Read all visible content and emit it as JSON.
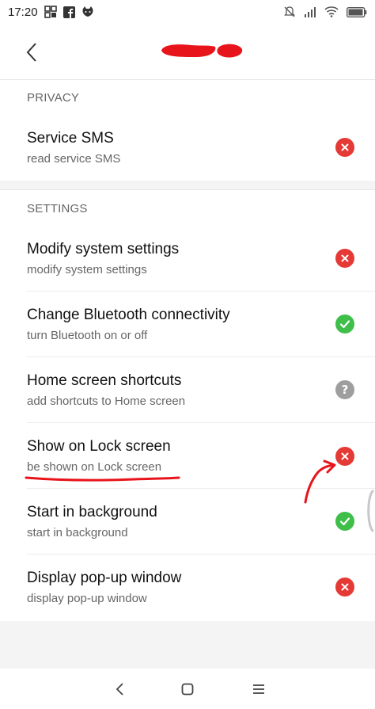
{
  "status_bar": {
    "time": "17:20",
    "left_icons": [
      "gallery-icon",
      "facebook-icon",
      "cat-icon"
    ],
    "right_icons": [
      "mute-bell-icon",
      "signal-icon",
      "wifi-icon",
      "battery-icon"
    ]
  },
  "header": {
    "back_icon": "back-chevron-icon",
    "title_redacted": true,
    "redaction_color": "#e8141b"
  },
  "sections": [
    {
      "header": "PRIVACY",
      "items": [
        {
          "title": "Service SMS",
          "subtitle": "read service SMS",
          "status": "denied"
        }
      ]
    },
    {
      "header": "SETTINGS",
      "items": [
        {
          "title": "Modify system settings",
          "subtitle": "modify system settings",
          "status": "denied"
        },
        {
          "title": "Change Bluetooth connectivity",
          "subtitle": "turn Bluetooth on or off",
          "status": "allowed"
        },
        {
          "title": "Home screen shortcuts",
          "subtitle": "add shortcuts to Home screen",
          "status": "ask"
        },
        {
          "title": "Show on Lock screen",
          "subtitle": "be shown on Lock screen",
          "status": "denied"
        },
        {
          "title": "Start in background",
          "subtitle": "start in background",
          "status": "allowed"
        },
        {
          "title": "Display pop-up window",
          "subtitle": "display pop-up window",
          "status": "denied"
        }
      ]
    }
  ],
  "status_colors": {
    "denied": "#e53935",
    "allowed": "#3fbf4a",
    "ask": "#9e9e9e"
  },
  "nav_bar": {
    "icons": [
      "nav-back-icon",
      "nav-home-icon",
      "nav-recents-icon"
    ]
  },
  "annotations": {
    "color": "#e8141b",
    "underline_target": "Show on Lock screen",
    "arrow_target": "Show on Lock screen status"
  }
}
